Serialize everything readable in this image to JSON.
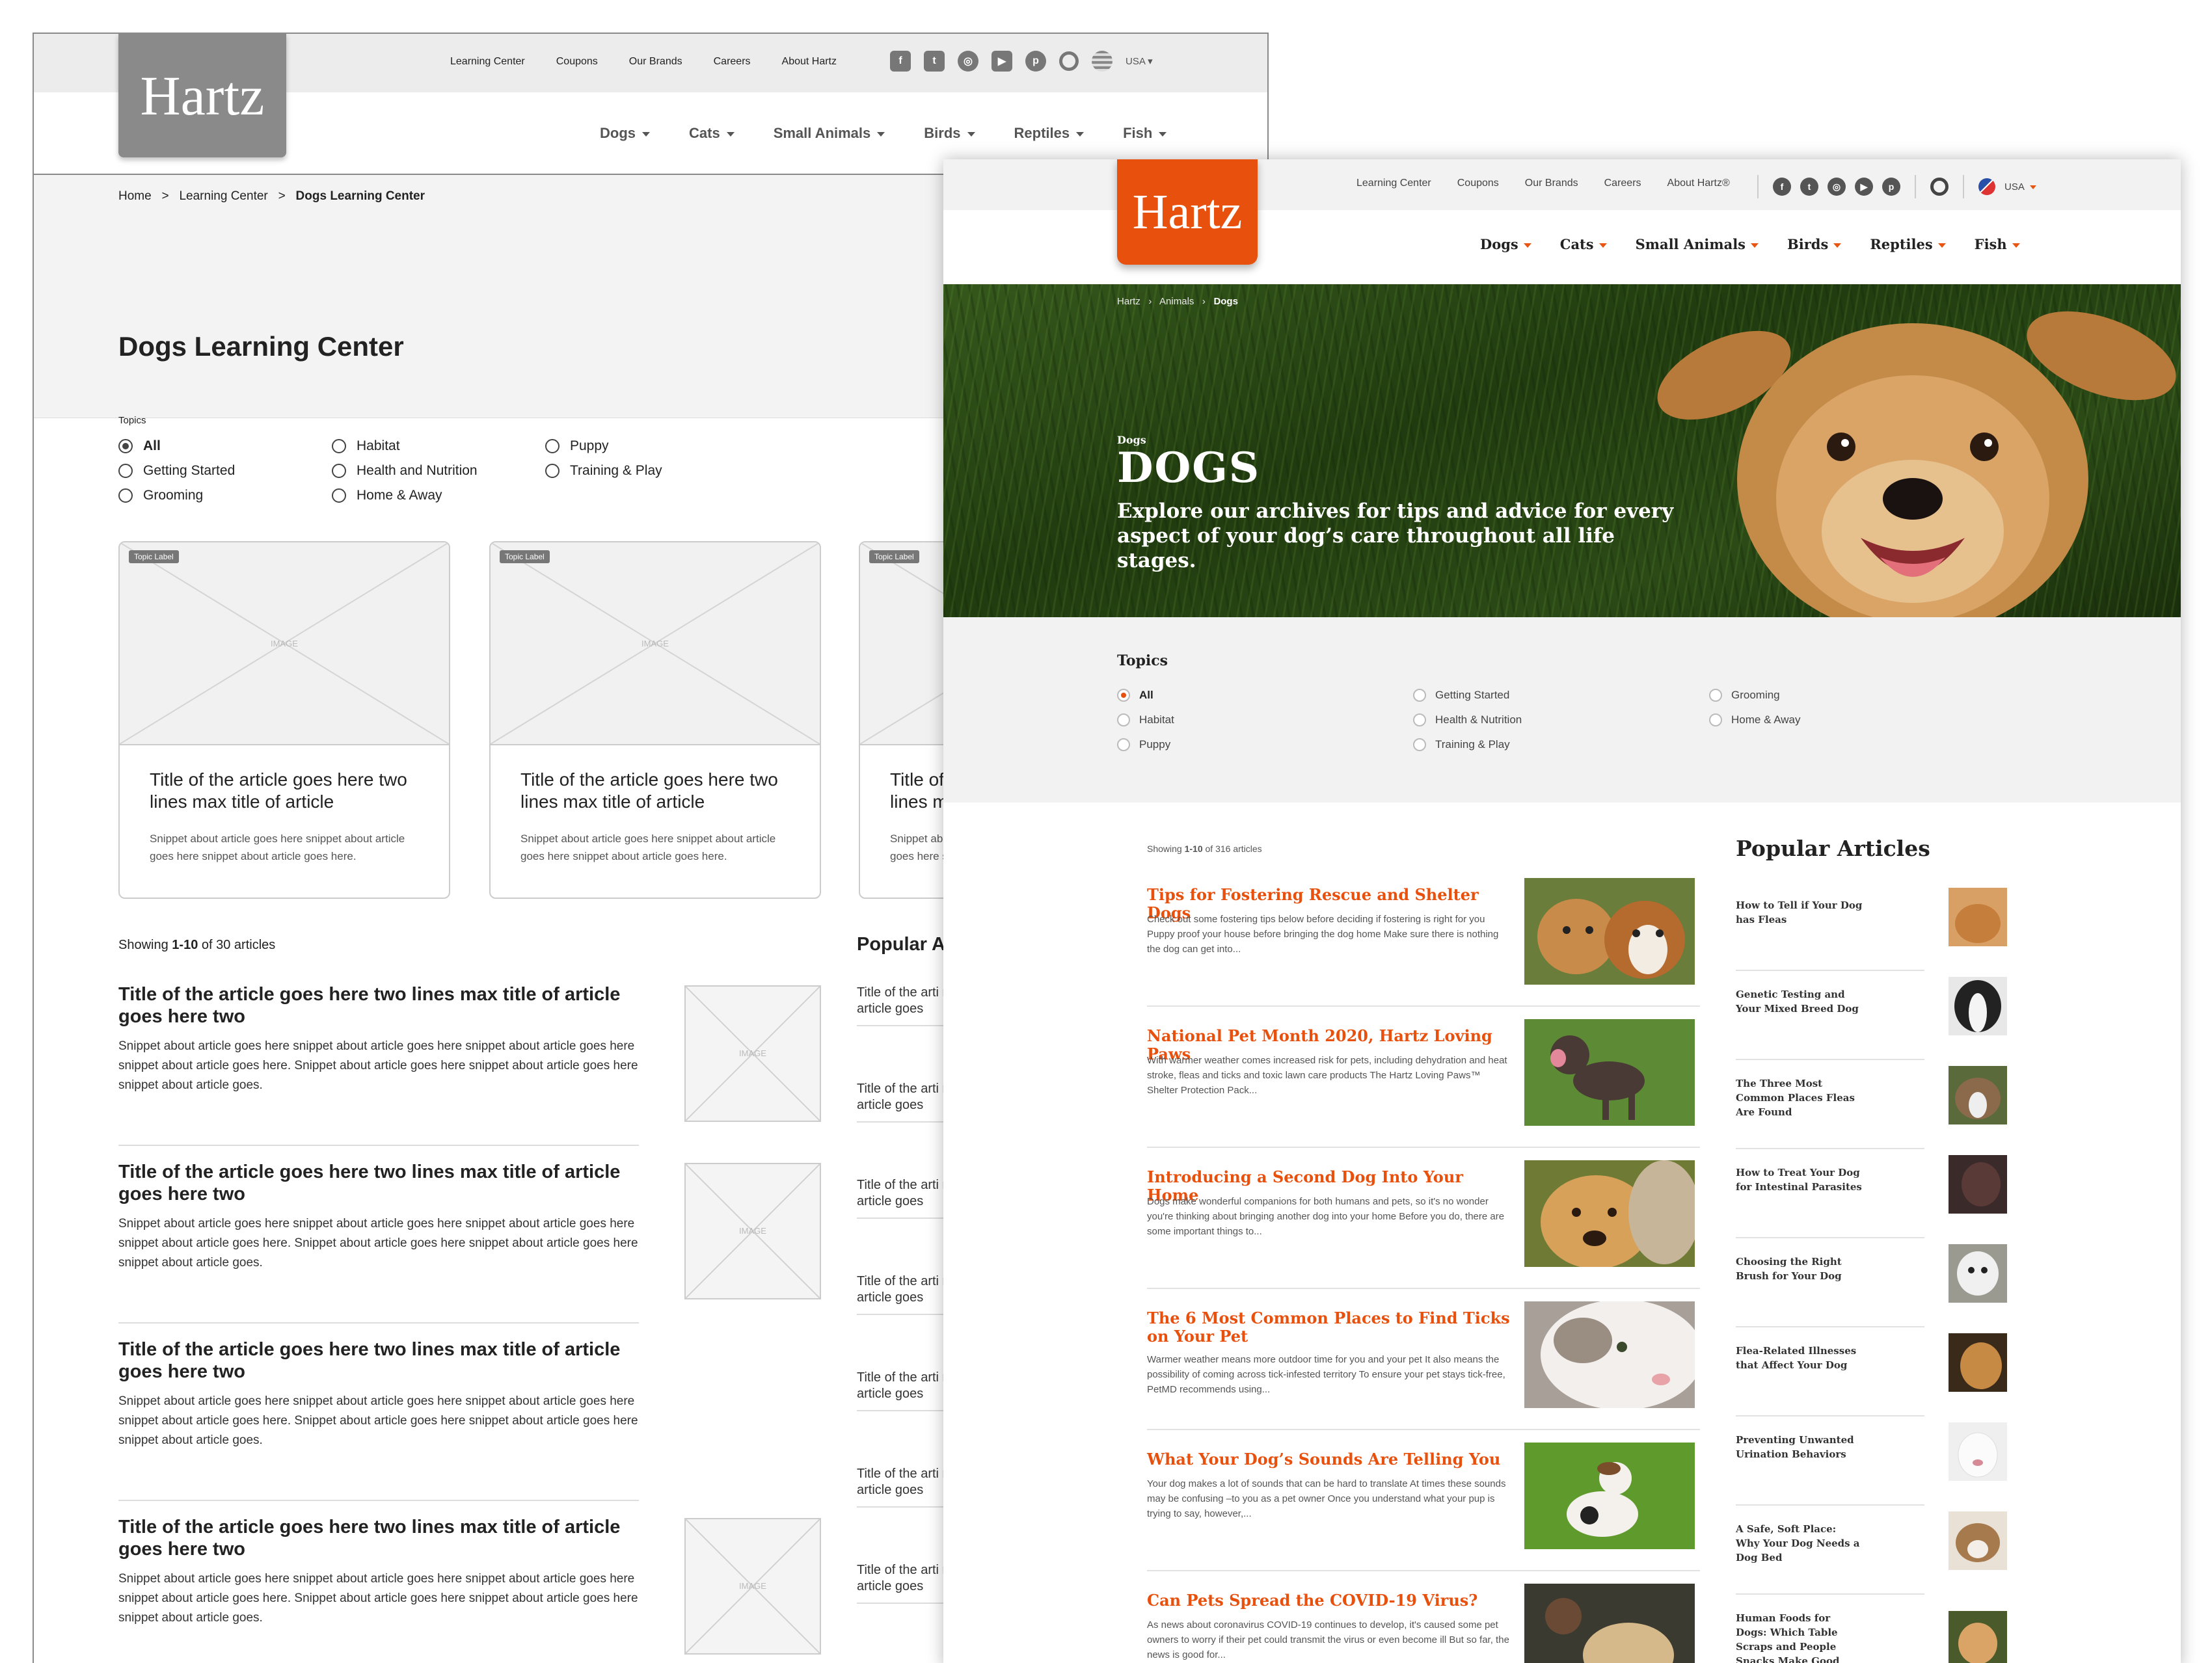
{
  "wireframe": {
    "logo": "Hartz",
    "utility_nav": [
      "Learning Center",
      "Coupons",
      "Our Brands",
      "Careers",
      "About Hartz"
    ],
    "social_icons": [
      "facebook-icon",
      "twitter-icon",
      "instagram-icon",
      "youtube-icon",
      "pinterest-icon"
    ],
    "region": "USA",
    "main_nav": [
      "Dogs",
      "Cats",
      "Small Animals",
      "Birds",
      "Reptiles",
      "Fish"
    ],
    "breadcrumb": {
      "home": "Home",
      "sep": ">",
      "learning": "Learning Center",
      "current": "Dogs Learning Center"
    },
    "page_title": "Dogs Learning Center",
    "topics_label": "Topics",
    "topics": [
      "All",
      "Habitat",
      "Puppy",
      "Getting Started",
      "Health and Nutrition",
      "Training & Play",
      "Grooming",
      "Home & Away"
    ],
    "selected_topic": "All",
    "card_tag": "Topic Label",
    "image_placeholder": "IMAGE",
    "cards": [
      {
        "title": "Title of the article goes here two lines max title of article",
        "snippet": "Snippet about article goes here snippet about article goes here snippet about article goes here."
      },
      {
        "title": "Title of the article goes here two lines max title of article",
        "snippet": "Snippet about article goes here snippet about article goes here snippet about article goes here."
      },
      {
        "title": "Title of the article goes here two lines max title of article",
        "snippet": "Snippet about article goes here snippet about article goes here snippet about article goes here."
      }
    ],
    "showing": {
      "prefix": "Showing ",
      "range": "1-10",
      "suffix": " of 30 articles"
    },
    "articles": [
      {
        "title": "Title of the article goes here two lines max title of article goes here two",
        "snippet": "Snippet about article goes here snippet about article goes here snippet about article goes here snippet about article goes here. Snippet about article goes here snippet about article goes here snippet about article goes."
      },
      {
        "title": "Title of the article goes here two lines max title of article goes here two",
        "snippet": "Snippet about article goes here snippet about article goes here snippet about article goes here snippet about article goes here. Snippet about article goes here snippet about article goes here snippet about article goes."
      },
      {
        "title": "Title of the article goes here two lines max title of article goes here two",
        "snippet": "Snippet about article goes here snippet about article goes here snippet about article goes here snippet about article goes here. Snippet about article goes here snippet about article goes here snippet about article goes."
      },
      {
        "title": "Title of the article goes here two lines max title of article goes here two",
        "snippet": "Snippet about article goes here snippet about article goes here snippet about article goes here snippet about article goes here. Snippet about article goes here snippet about article goes here snippet about article goes."
      }
    ],
    "popular_title": "Popular Ar",
    "popular_item": "Title of the arti max title of art article goes"
  },
  "hartz": {
    "logo": "Hartz",
    "utility_nav": [
      "Learning Center",
      "Coupons",
      "Our Brands",
      "Careers",
      "About Hartz®"
    ],
    "social_icons": [
      "facebook-icon",
      "twitter-icon",
      "instagram-icon",
      "youtube-icon",
      "pinterest-icon"
    ],
    "region": "USA",
    "main_nav": [
      "Dogs",
      "Cats",
      "Small Animals",
      "Birds",
      "Reptiles",
      "Fish"
    ],
    "breadcrumb": {
      "a": "Hartz",
      "b": "Animals",
      "c": "Dogs",
      "sep": "›"
    },
    "hero": {
      "eyebrow": "Dogs",
      "title": "DOGS",
      "lede": "Explore our archives for tips and advice for every aspect of your dog’s care throughout all life stages."
    },
    "topics_label": "Topics",
    "topics": [
      "All",
      "Getting Started",
      "Grooming",
      "Habitat",
      "Health & Nutrition",
      "Home & Away",
      "Puppy",
      "Training & Play"
    ],
    "selected_topic": "All",
    "showing": {
      "prefix": "Showing ",
      "range": "1-10",
      "suffix": " of 316 articles"
    },
    "articles": [
      {
        "title": "Tips for Fostering Rescue and Shelter Dogs",
        "snippet": "Check out some fostering tips below before deciding if fostering is right for you Puppy proof your house before bringing the dog home Make sure there is nothing the dog can get into..."
      },
      {
        "title": "National Pet Month 2020, Hartz Loving Paws",
        "snippet": "With warmer weather comes increased risk for pets, including dehydration and heat stroke, fleas and ticks and toxic lawn care products The Hartz Loving Paws™ Shelter Protection Pack..."
      },
      {
        "title": "Introducing a Second Dog Into Your Home",
        "snippet": "Dogs make wonderful companions for both humans and pets, so it's no wonder you're thinking about bringing another dog into your home Before you do, there are some important things to..."
      },
      {
        "title": "The 6 Most Common Places to Find Ticks on Your Pet",
        "snippet": "Warmer weather means more outdoor time for you and your pet It also means the possibility of coming across tick-infested territory To ensure your pet stays tick-free, PetMD recommends using..."
      },
      {
        "title": "What Your Dog’s Sounds Are Telling You",
        "snippet": "Your dog makes a lot of sounds that can be hard to translate At times these sounds may be confusing –to you as a pet owner Once you understand what your pup is trying to say, however,..."
      },
      {
        "title": "Can Pets Spread the COVID-19 Virus?",
        "snippet": "As news about coronavirus COVID-19 continues to develop, it's caused some pet owners to worry if their pet could transmit the virus or even become ill But so far, the news is good for..."
      }
    ],
    "popular_title": "Popular Articles",
    "popular": [
      "How to Tell if Your Dog has Fleas",
      "Genetic Testing and Your Mixed Breed Dog",
      "The Three Most Common Places Fleas Are Found",
      "How to Treat Your Dog for Intestinal Parasites",
      "Choosing the Right Brush for Your Dog",
      "Flea-Related Illnesses that Affect Your Dog",
      "Preventing Unwanted Urination Behaviors",
      "A Safe, Soft Place: Why Your Dog Needs a Dog Bed",
      "Human Foods for Dogs: Which Table Scraps and People Snacks Make Good Dog Treats"
    ],
    "accent": "#e8500e"
  }
}
